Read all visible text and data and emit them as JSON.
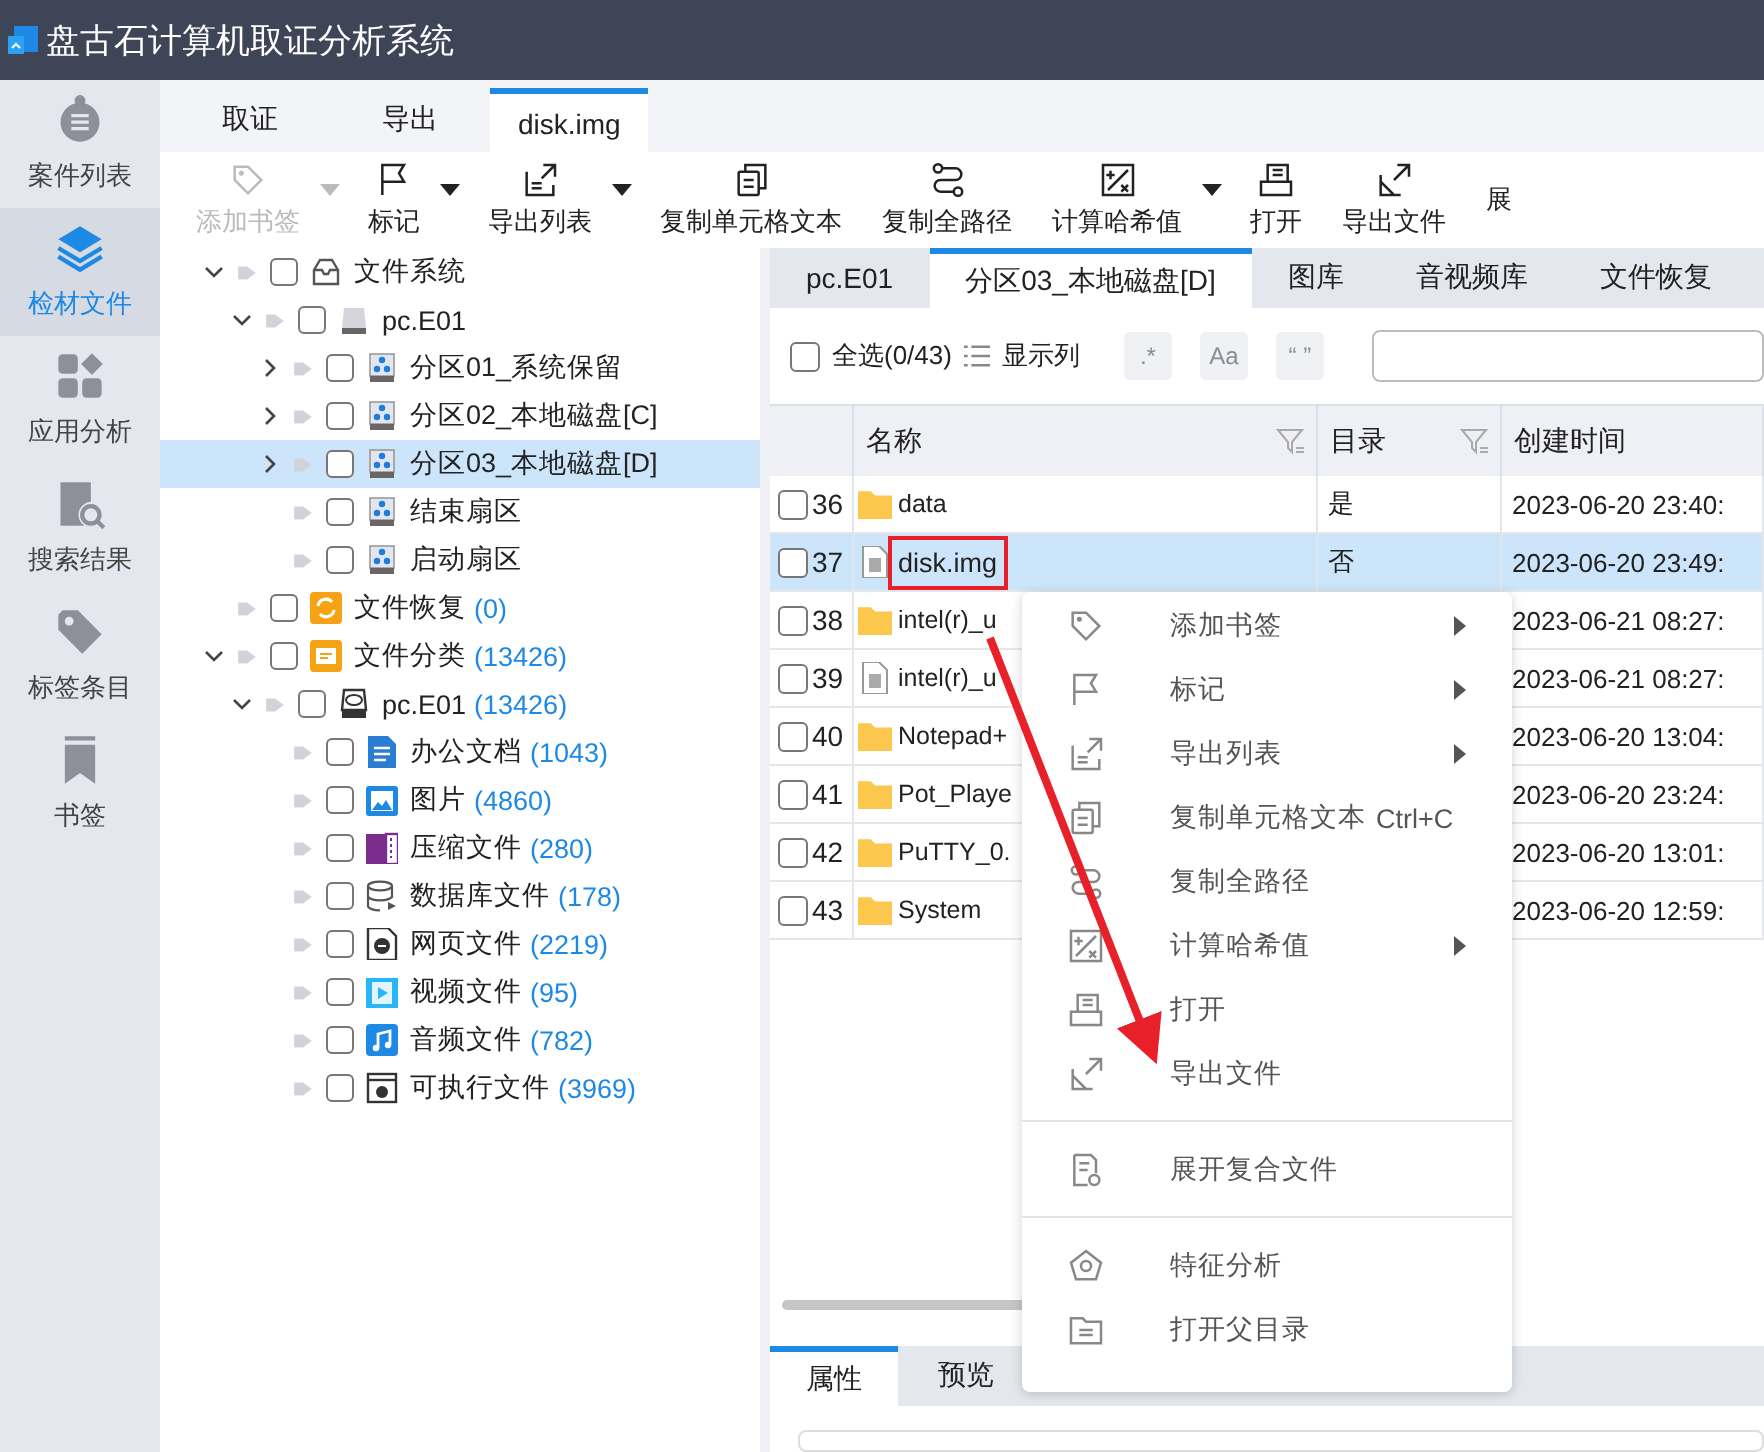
{
  "window": {
    "title": "盘古石计算机取证分析系统"
  },
  "nav": [
    {
      "label": "案件列表",
      "kind": "case",
      "selected": false
    },
    {
      "label": "检材文件",
      "kind": "evidence",
      "selected": true
    },
    {
      "label": "应用分析",
      "kind": "apps",
      "selected": false
    },
    {
      "label": "搜索结果",
      "kind": "search",
      "selected": false
    },
    {
      "label": "标签条目",
      "kind": "tag",
      "selected": false
    },
    {
      "label": "书签",
      "kind": "bookmark",
      "selected": false
    }
  ],
  "tabs": [
    {
      "label": "取证",
      "selected": false
    },
    {
      "label": "导出",
      "selected": false
    },
    {
      "label": "disk.img",
      "selected": true
    }
  ],
  "toolbar": [
    {
      "label": "添加书签",
      "kind": "bookmark",
      "disabled": true,
      "dropdown": true
    },
    {
      "label": "标记",
      "kind": "flag",
      "disabled": false,
      "dropdown": true
    },
    {
      "label": "导出列表",
      "kind": "export-list",
      "disabled": false,
      "dropdown": true
    },
    {
      "label": "复制单元格文本",
      "kind": "copy",
      "disabled": false,
      "dropdown": false
    },
    {
      "label": "复制全路径",
      "kind": "path",
      "disabled": false,
      "dropdown": false
    },
    {
      "label": "计算哈希值",
      "kind": "hash",
      "disabled": false,
      "dropdown": true
    },
    {
      "label": "打开",
      "kind": "open",
      "disabled": false,
      "dropdown": false
    },
    {
      "label": "导出文件",
      "kind": "export",
      "disabled": false,
      "dropdown": false
    },
    {
      "label": "展",
      "kind": "none",
      "disabled": false,
      "dropdown": false
    }
  ],
  "tree": [
    {
      "label": "文件系统",
      "kind": "filesystem",
      "expanded": true,
      "checked": false,
      "selected": false,
      "children": [
        {
          "label": "pc.E01",
          "kind": "disk",
          "expanded": true,
          "checked": false,
          "selected": false,
          "children": [
            {
              "label": "分区01_系统保留",
              "kind": "partition",
              "expanded": false,
              "checked": false,
              "selected": false
            },
            {
              "label": "分区02_本地磁盘[C]",
              "kind": "partition",
              "expanded": false,
              "checked": false,
              "selected": false
            },
            {
              "label": "分区03_本地磁盘[D]",
              "kind": "partition",
              "expanded": false,
              "checked": false,
              "selected": true
            },
            {
              "label": "结束扇区",
              "kind": "partition",
              "checked": false,
              "selected": false
            },
            {
              "label": "启动扇区",
              "kind": "partition",
              "checked": false,
              "selected": false
            }
          ]
        }
      ]
    },
    {
      "label": "文件恢复",
      "count": "(0)",
      "kind": "recovery",
      "checked": false,
      "selected": false
    },
    {
      "label": "文件分类",
      "count": "(13426)",
      "kind": "category",
      "expanded": true,
      "checked": false,
      "selected": false,
      "children": [
        {
          "label": "pc.E01",
          "count": "(13426)",
          "kind": "drive",
          "expanded": true,
          "checked": false,
          "selected": false,
          "children": [
            {
              "label": "办公文档",
              "count": "(1043)",
              "kind": "document",
              "checked": false,
              "selected": false
            },
            {
              "label": "图片",
              "count": "(4860)",
              "kind": "image",
              "checked": false,
              "selected": false
            },
            {
              "label": "压缩文件",
              "count": "(280)",
              "kind": "archive",
              "checked": false,
              "selected": false
            },
            {
              "label": "数据库文件",
              "count": "(178)",
              "kind": "database",
              "checked": false,
              "selected": false
            },
            {
              "label": "网页文件",
              "count": "(2219)",
              "kind": "web",
              "checked": false,
              "selected": false
            },
            {
              "label": "视频文件",
              "count": "(95)",
              "kind": "video",
              "checked": false,
              "selected": false
            },
            {
              "label": "音频文件",
              "count": "(782)",
              "kind": "audio",
              "checked": false,
              "selected": false
            },
            {
              "label": "可执行文件",
              "count": "(3969)",
              "kind": "executable",
              "checked": false,
              "selected": false
            }
          ]
        }
      ]
    }
  ],
  "pane_tabs": [
    {
      "label": "pc.E01",
      "selected": false
    },
    {
      "label": "分区03_本地磁盘[D]",
      "selected": true
    },
    {
      "label": "图库",
      "selected": false
    },
    {
      "label": "音视频库",
      "selected": false
    },
    {
      "label": "文件恢复",
      "selected": false
    }
  ],
  "list_toolbar": {
    "select_all": {
      "label": "全选(0/43)",
      "checked": false
    },
    "columns_button": "显示列",
    "options": [
      ".*",
      "Aa",
      "“ ”"
    ]
  },
  "table": {
    "columns": [
      "名称",
      "目录",
      "创建时间"
    ],
    "rows": [
      {
        "number": "36",
        "name": "data",
        "kind": "folder",
        "directory": "是",
        "created": "2023-06-20 23:40:",
        "checked": false,
        "selected": false,
        "outlined": false
      },
      {
        "number": "37",
        "name": "disk.img",
        "kind": "file",
        "directory": "否",
        "created": "2023-06-20 23:49:",
        "checked": false,
        "selected": true,
        "outlined": true
      },
      {
        "number": "38",
        "name": "intel(r)_u",
        "kind": "folder",
        "created": "2023-06-21 08:27:",
        "checked": false,
        "selected": false,
        "outlined": false
      },
      {
        "number": "39",
        "name": "intel(r)_u",
        "kind": "file",
        "created": "2023-06-21 08:27:",
        "checked": false,
        "selected": false,
        "outlined": false
      },
      {
        "number": "40",
        "name": "Notepad+",
        "kind": "folder",
        "created": "2023-06-20 13:04:",
        "checked": false,
        "selected": false,
        "outlined": false
      },
      {
        "number": "41",
        "name": "Pot_Playe",
        "kind": "folder",
        "created": "2023-06-20 23:24:",
        "checked": false,
        "selected": false,
        "outlined": false
      },
      {
        "number": "42",
        "name": "PuTTY_0.",
        "kind": "folder",
        "created": "2023-06-20 13:01:",
        "checked": false,
        "selected": false,
        "outlined": false
      },
      {
        "number": "43",
        "name": "System",
        "kind": "folder",
        "created": "2023-06-20 12:59:",
        "checked": false,
        "selected": false,
        "outlined": false
      }
    ]
  },
  "bottom_tabs": [
    {
      "label": "属性",
      "selected": true
    },
    {
      "label": "预览",
      "selected": false
    }
  ],
  "context_menu": [
    {
      "kind": "bookmark",
      "label": "添加书签",
      "submenu": true
    },
    {
      "kind": "flag",
      "label": "标记",
      "submenu": true
    },
    {
      "kind": "export-list",
      "label": "导出列表",
      "submenu": true
    },
    {
      "kind": "copy",
      "label": "复制单元格文本",
      "shortcut": "Ctrl+C"
    },
    {
      "kind": "path",
      "label": "复制全路径"
    },
    {
      "kind": "hash",
      "label": "计算哈希值",
      "submenu": true
    },
    {
      "kind": "open",
      "label": "打开"
    },
    {
      "kind": "export",
      "label": "导出文件",
      "pointed": true
    },
    {
      "kind": "divider"
    },
    {
      "kind": "compound",
      "label": "展开复合文件"
    },
    {
      "kind": "divider"
    },
    {
      "kind": "feature",
      "label": "特征分析"
    },
    {
      "kind": "folder",
      "label": "打开父目录"
    }
  ]
}
